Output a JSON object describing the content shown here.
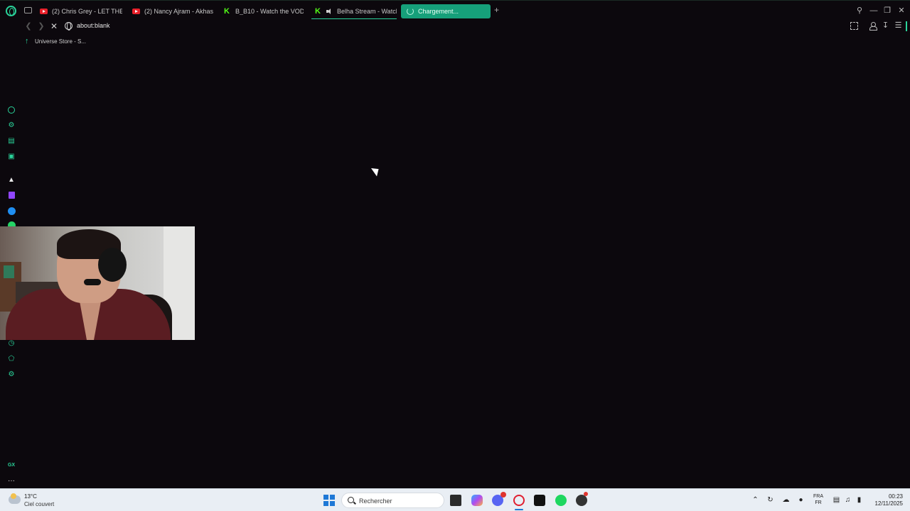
{
  "browser": {
    "tabs": [
      {
        "label": "(2) Chris Grey - LET THE",
        "icon": "youtube-icon"
      },
      {
        "label": "(2) Nancy Ajram - Akhasm",
        "icon": "youtube-icon"
      },
      {
        "label": "B_B10 - Watch the VOD o",
        "icon": "kick-icon"
      },
      {
        "label": "Belha Stream - Watch",
        "icon": "kick-icon",
        "audio": true
      },
      {
        "label": "Chargement...",
        "icon": "spinner-icon",
        "active": true
      }
    ],
    "address": {
      "url": "about:blank"
    },
    "bookmarks": [
      {
        "label": "Universe Store - S..."
      }
    ],
    "sidebar": {
      "icons": [
        "speed-dial-icon",
        "player-icon",
        "tracker-icon",
        "news-icon",
        "aria-icon",
        "twitch-icon",
        "messenger-icon",
        "whatsapp-icon",
        "history-icon",
        "extensions-icon",
        "settings-icon",
        "gx-control-icon",
        "more-icon"
      ],
      "gx_label": "GX",
      "more_label": "···"
    },
    "accent_color": "#2ad39a"
  },
  "taskbar": {
    "weather": {
      "temp": "13°C",
      "desc": "Ciel couvert"
    },
    "search_placeholder": "Rechercher",
    "lang_line1": "FRA",
    "lang_line2": "FR",
    "time": "00:23",
    "date": "12/11/2025"
  }
}
